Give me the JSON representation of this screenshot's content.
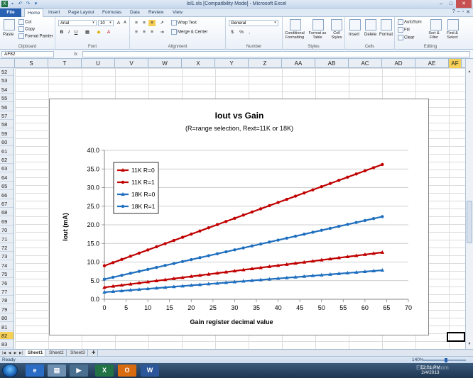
{
  "window": {
    "title": "lol1.xls  [Compatibility Mode]  -  Microsoft Excel"
  },
  "ribbon_tabs": [
    "File",
    "Home",
    "Insert",
    "Page Layout",
    "Formulas",
    "Data",
    "Review",
    "View"
  ],
  "ribbon": {
    "clipboard": {
      "paste": "Paste",
      "cut": "Cut",
      "copy": "Copy",
      "format_painter": "Format Painter",
      "label": "Clipboard"
    },
    "font": {
      "name": "Arial",
      "size": "10",
      "bold": "B",
      "italic": "I",
      "underline": "U",
      "grow": "A",
      "shrink": "A",
      "label": "Font"
    },
    "alignment": {
      "wrap_text": "Wrap Text",
      "merge_center": "Merge & Center",
      "label": "Alignment"
    },
    "number": {
      "format": "General",
      "currency": "$",
      "percent": "%",
      "comma": ",",
      "label": "Number"
    },
    "styles": {
      "conditional": "Conditional Formatting",
      "format_table": "Format as Table",
      "cell_styles": "Cell Styles",
      "label": "Styles"
    },
    "cells": {
      "insert": "Insert",
      "delete": "Delete",
      "format": "Format",
      "label": "Cells"
    },
    "editing": {
      "autosum": "AutoSum",
      "fill": "Fill",
      "clear": "Clear",
      "sort_filter": "Sort & Filter",
      "find_select": "Find & Select",
      "label": "Editing"
    }
  },
  "formula_bar": {
    "name_box": "AF82",
    "fx": "fx",
    "value": ""
  },
  "columns": [
    "S",
    "T",
    "U",
    "V",
    "W",
    "X",
    "Y",
    "Z",
    "AA",
    "AB",
    "AC",
    "AD",
    "AE",
    "AF"
  ],
  "selected_column": "AF",
  "rows": [
    "52",
    "53",
    "54",
    "55",
    "56",
    "57",
    "58",
    "59",
    "60",
    "61",
    "62",
    "63",
    "64",
    "65",
    "66",
    "67",
    "68",
    "69",
    "70",
    "71",
    "72",
    "73",
    "74",
    "75",
    "76",
    "77",
    "78",
    "79",
    "80",
    "81",
    "82",
    "83"
  ],
  "selected_row": "82",
  "sheet_tabs": [
    "Sheet1",
    "Sheet2",
    "Sheet3"
  ],
  "active_sheet": "Sheet1",
  "status": {
    "ready": "Ready",
    "zoom": "140%"
  },
  "taskbar": {
    "time": "12:01 PM",
    "date": "2/4/2013"
  },
  "watermark": "EEchart.com",
  "colors": {
    "series_red": "#c00000",
    "series_blue": "#1f6fbf",
    "excel_green": "#217346",
    "selected_header": "#f6cf57"
  },
  "chart_data": {
    "type": "line",
    "title": "Iout vs Gain",
    "subtitle": "(R=range selection, Rext=11K or 18K)",
    "xlabel": "Gain register decimal value",
    "ylabel": "Iout (mA)",
    "xlim": [
      0,
      70
    ],
    "ylim": [
      0,
      40
    ],
    "x_ticks": [
      "0",
      "5",
      "10",
      "15",
      "20",
      "25",
      "30",
      "35",
      "40",
      "45",
      "50",
      "55",
      "60",
      "65",
      "70"
    ],
    "y_ticks": [
      "0.0",
      "5.0",
      "10.0",
      "15.0",
      "20.0",
      "25.0",
      "30.0",
      "35.0",
      "40.0"
    ],
    "grid": true,
    "legend_position": "top-left",
    "series": [
      {
        "name": "11K R=0",
        "color": "#c00000",
        "marker": "triangle",
        "x_start": 0,
        "x_end": 64,
        "x_step": 2,
        "y_start": 3.2,
        "y_end": 12.6
      },
      {
        "name": "11K R=1",
        "color": "#c00000",
        "marker": "circle",
        "x_start": 0,
        "x_end": 64,
        "x_step": 2,
        "y_start": 9.0,
        "y_end": 36.2
      },
      {
        "name": "18K R=0",
        "color": "#1f6fbf",
        "marker": "triangle",
        "x_start": 0,
        "x_end": 64,
        "x_step": 2,
        "y_start": 1.9,
        "y_end": 7.8
      },
      {
        "name": "18K R=1",
        "color": "#1f6fbf",
        "marker": "circle",
        "x_start": 0,
        "x_end": 64,
        "x_step": 2,
        "y_start": 5.4,
        "y_end": 22.2
      }
    ]
  }
}
